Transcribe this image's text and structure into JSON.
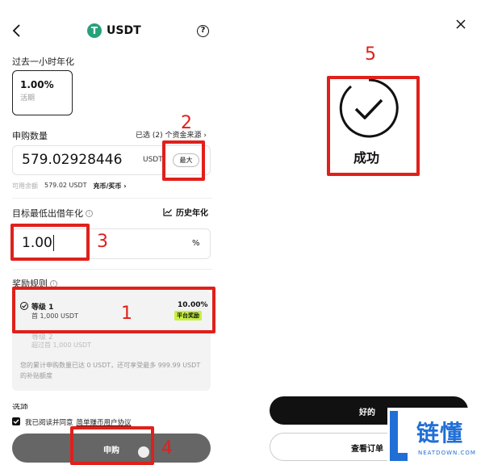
{
  "left": {
    "header": {
      "title": "USDT"
    },
    "apr_section": {
      "title": "过去一小时年化",
      "value": "1.00%",
      "sub": "活期"
    },
    "amount": {
      "title": "申购数量",
      "selected": "已选 (2) 个资金来源",
      "value": "579.02928446",
      "currency": "USDT",
      "max_label": "最大",
      "available_label": "可用余额",
      "available_value": "579.02 USDT",
      "deposit_link": "充币/买币"
    },
    "target": {
      "title": "目标最低出借年化",
      "history_label": "历史年化",
      "value": "1.00",
      "unit": "%"
    },
    "rewards": {
      "title": "奖励规则",
      "tier1": {
        "name": "等级 1",
        "desc": "首 1,000 USDT",
        "rate": "10.00%",
        "badge": "平台奖励"
      },
      "tier2": {
        "name": "等级 2",
        "desc": "超过首 1,000 USDT"
      },
      "note": "您的累计申购数量已达 0 USDT，还可享受最多 999.99 USDT 的补贴额度"
    },
    "partial_label": "选项",
    "agree": {
      "prefix": "我已阅读并同意",
      "link": "简单赚币用户协议"
    },
    "submit_label": "申购"
  },
  "right": {
    "status": "成功",
    "ok_label": "好的",
    "view_label": "查看订单"
  },
  "annotations": [
    "1",
    "2",
    "3",
    "4",
    "5"
  ],
  "watermark": {
    "cn": "链懂",
    "en": "NEATDOWN.COM"
  },
  "colors": {
    "accent": "#e0201b",
    "tether": "#26a17b",
    "badge_bg": "#c8f040",
    "button_dark": "#666666"
  }
}
